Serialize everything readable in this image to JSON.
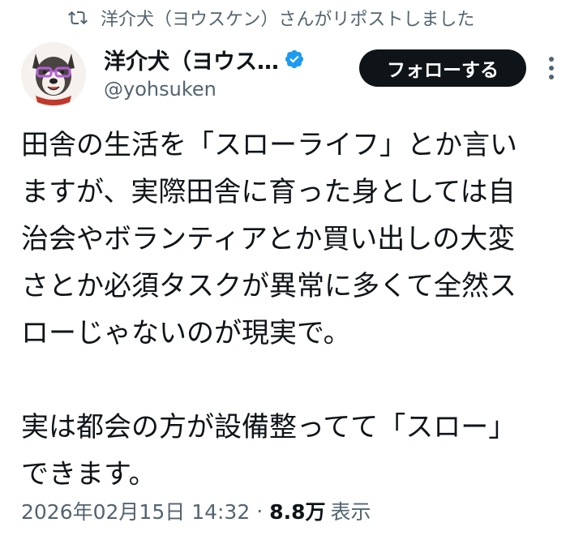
{
  "repost": {
    "text": "洋介犬（ヨウスケン）さんがリポストしました",
    "icon": "repost-icon"
  },
  "author": {
    "display_name": "洋介犬（ヨウス…",
    "handle": "@yohsuken",
    "verified_icon": "verified-badge-icon",
    "verified_color": "#1d9bf0"
  },
  "follow_button": {
    "label": "フォローする"
  },
  "more_icon": "more-vertical-icon",
  "tweet": {
    "lines": [
      "田舎の生活を「スローライフ」とか言い",
      "ますが、実際田舎に育った身としては自",
      "治会やボランティアとか買い出しの大変",
      "さとか必須タスクが異常に多くて全然ス",
      "ローじゃないのが現実で。",
      "",
      "実は都会の方が設備整ってて「スロー」",
      "できます。"
    ]
  },
  "meta": {
    "timestamp": "2026年02月15日 14:32",
    "separator": "·",
    "views_count": "8.8万",
    "views_label": "表示"
  }
}
